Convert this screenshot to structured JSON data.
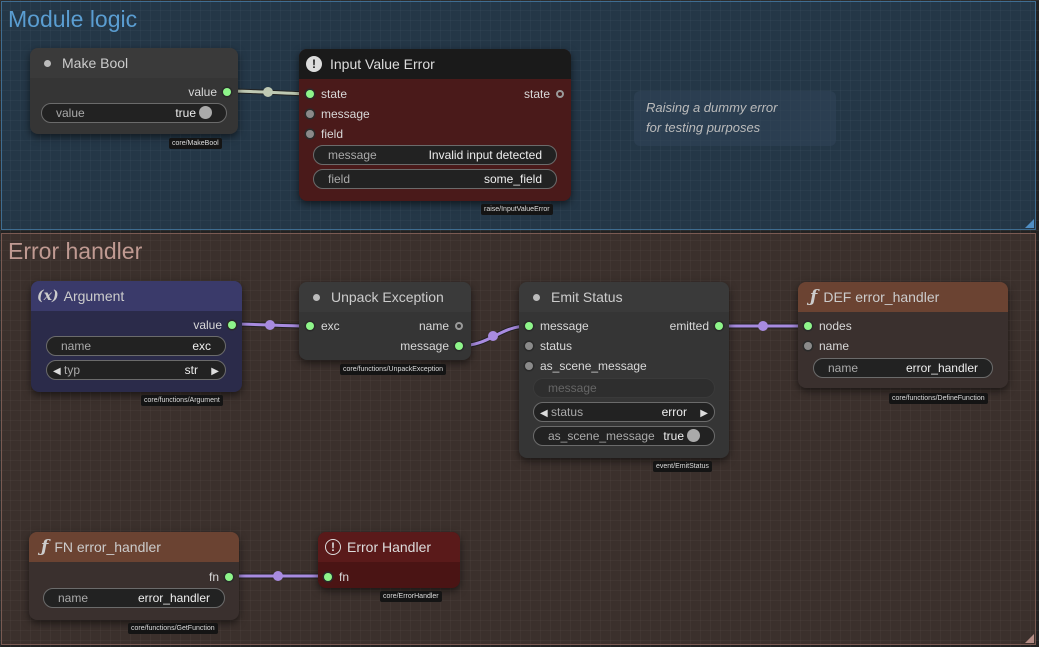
{
  "groups": {
    "module": "Module logic",
    "error": "Error handler"
  },
  "note": {
    "line1": "Raising a dummy error",
    "line2": "for testing purposes"
  },
  "make_bool": {
    "title": "Make Bool",
    "out_value": "value",
    "w_label": "value",
    "w_value": "true",
    "tag": "core/MakeBool"
  },
  "input_error": {
    "title": "Input Value Error",
    "icon": "exclamation-icon",
    "in_state": "state",
    "in_message": "message",
    "in_field": "field",
    "out_state": "state",
    "w_message_label": "message",
    "w_message_value": "Invalid input detected",
    "w_field_label": "field",
    "w_field_value": "some_field",
    "tag": "raise/InputValueError"
  },
  "argument": {
    "title": "Argument",
    "icon": "(x)",
    "out_value": "value",
    "w_name_label": "name",
    "w_name_value": "exc",
    "w_typ_label": "typ",
    "w_typ_value": "str",
    "tag": "core/functions/Argument"
  },
  "unpack": {
    "title": "Unpack Exception",
    "in_exc": "exc",
    "out_name": "name",
    "out_message": "message",
    "tag": "core/functions/UnpackException"
  },
  "emit": {
    "title": "Emit Status",
    "in_message": "message",
    "in_status": "status",
    "in_scene": "as_scene_message",
    "out_emitted": "emitted",
    "w_message_placeholder": "message",
    "w_status_label": "status",
    "w_status_value": "error",
    "w_scene_label": "as_scene_message",
    "w_scene_value": "true",
    "tag": "event/EmitStatus"
  },
  "def_fn": {
    "title": "DEF error_handler",
    "icon": "ƒ",
    "in_nodes": "nodes",
    "in_name": "name",
    "w_name_label": "name",
    "w_name_value": "error_handler",
    "tag": "core/functions/DefineFunction"
  },
  "get_fn": {
    "title": "FN error_handler",
    "icon": "ƒ",
    "out_fn": "fn",
    "w_name_label": "name",
    "w_name_value": "error_handler",
    "tag": "core/functions/GetFunction"
  },
  "err_handler": {
    "title": "Error Handler",
    "icon": "exclamation-icon",
    "in_fn": "fn",
    "tag": "core/ErrorHandler"
  },
  "colors": {
    "module_group": "#3f6d91",
    "error_group": "#7a5a52",
    "active_socket": "#8ef58a",
    "wire": "#a88be0",
    "bool_wire": "#bfc9b3"
  }
}
